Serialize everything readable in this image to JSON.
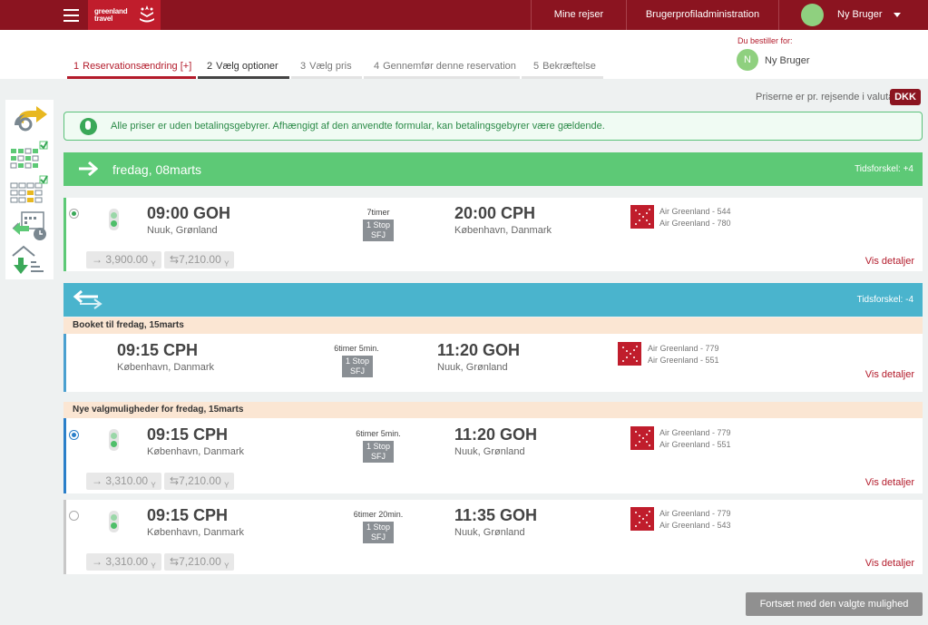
{
  "header": {
    "logo_text": "greenland travel",
    "nav": {
      "my_trips": "Mine rejser",
      "profile_admin": "Brugerprofiladministration",
      "user": "Ny Bruger"
    }
  },
  "steps": [
    {
      "num": "1",
      "label": "Reservationsændring [+]"
    },
    {
      "num": "2",
      "label": "Vælg optioner"
    },
    {
      "num": "3",
      "label": "Vælg pris"
    },
    {
      "num": "4",
      "label": "Gennemfør denne reservation"
    },
    {
      "num": "5",
      "label": "Bekræftelse"
    }
  ],
  "booker": {
    "label": "Du bestiller for:",
    "initial": "N",
    "name": "Ny Bruger"
  },
  "currency": {
    "note": "Priserne er pr. rejsende i valuta",
    "code": "DKK"
  },
  "info": {
    "text": "Alle priser er uden betalingsgebyrer. Afhængigt af den anvendte formular, kan betalingsgebyrer være gældende."
  },
  "outbound": {
    "date": "fredag, 08marts",
    "tz": "Tidsforskel: +4",
    "flight": {
      "dep_time": "09:00 GOH",
      "dep_city": "Nuuk, Grønland",
      "duration": "7timer",
      "stops": "1 Stop",
      "via": "SFJ",
      "arr_time": "20:00 CPH",
      "arr_city": "København, Danmark",
      "flights": [
        "Air Greenland - 544",
        "Air Greenland - 780"
      ],
      "price_one": "3,900.00",
      "price_return": "7,210.00",
      "cls": "Y",
      "details": "Vis detaljer"
    }
  },
  "return": {
    "tz": "Tidsforskel: -4",
    "booked_header": "Booket til fredag, 15marts",
    "booked": {
      "dep_time": "09:15 CPH",
      "dep_city": "København, Danmark",
      "duration": "6timer 5min.",
      "stops": "1 Stop",
      "via": "SFJ",
      "arr_time": "11:20 GOH",
      "arr_city": "Nuuk, Grønland",
      "flights": [
        "Air Greenland - 779",
        "Air Greenland - 551"
      ],
      "details": "Vis detaljer"
    },
    "options_header": "Nye valgmuligheder for fredag, 15marts",
    "options": [
      {
        "dep_time": "09:15 CPH",
        "dep_city": "København, Danmark",
        "duration": "6timer 5min.",
        "stops": "1 Stop",
        "via": "SFJ",
        "arr_time": "11:20 GOH",
        "arr_city": "Nuuk, Grønland",
        "flights": [
          "Air Greenland - 779",
          "Air Greenland - 551"
        ],
        "price_one": "3,310.00",
        "price_return": "7,210.00",
        "cls": "Y",
        "details": "Vis detaljer"
      },
      {
        "dep_time": "09:15 CPH",
        "dep_city": "København, Danmark",
        "duration": "6timer 20min.",
        "stops": "1 Stop",
        "via": "SFJ",
        "arr_time": "11:35 GOH",
        "arr_city": "Nuuk, Grønland",
        "flights": [
          "Air Greenland - 779",
          "Air Greenland - 543"
        ],
        "price_one": "3,310.00",
        "price_return": "7,210.00",
        "cls": "Y",
        "details": "Vis detaljer"
      }
    ]
  },
  "continue_label": "Fortsæt med den valgte mulighed",
  "colors": {
    "brand": "#8b1420",
    "outbound": "#5dc976",
    "return": "#4ab4cd",
    "booked_bg": "#fbe6d3"
  }
}
